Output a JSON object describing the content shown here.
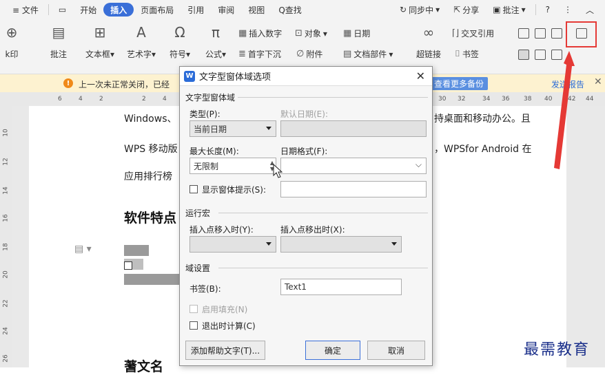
{
  "menubar": {
    "items": [
      "≡ 文件",
      "开始",
      "插入",
      "页面布局",
      "引用",
      "审阅",
      "视图"
    ],
    "active": "插入",
    "search": "Q查找",
    "sync": "同步中",
    "share": "分享",
    "comment": "批注",
    "help": "?"
  },
  "ribbon": {
    "left_cut": "k印",
    "comment": "批注",
    "textbox": "文本框",
    "art": "艺术字",
    "symbol": "符号",
    "formula": "公式",
    "insert_number": "插入数字",
    "object": "对象",
    "date": "日期",
    "dropcap": "首字下沉",
    "attach": "附件",
    "docpart": "文档部件",
    "hyperlink": "超链接",
    "crossref": "交叉引用",
    "bookmark": "书签"
  },
  "notify": {
    "message": "上一次未正常关闭，已经",
    "backup_link": "查看更多备份",
    "report": "发送报告"
  },
  "ruler": {
    "marks": [
      "6",
      "4",
      "2",
      "2",
      "4",
      "30",
      "32",
      "34",
      "36",
      "38",
      "40",
      "42",
      "44"
    ]
  },
  "vruler": {
    "marks": [
      "10",
      "12",
      "14",
      "16",
      "18",
      "20",
      "22",
      "24",
      "26"
    ]
  },
  "document": {
    "line1": "Windows、",
    "line1_end": "持桌面和移动办公。且",
    "line2": "WPS 移动版",
    "line2_end": "，WPSfor Android 在",
    "line3": "应用排行榜",
    "heading": "软件特点",
    "bottom_heading": "蓍文名"
  },
  "watermark": "最需教育",
  "dialog": {
    "title": "文字型窗体域选项",
    "section_field": "文字型窗体域",
    "type_label": "类型(P):",
    "type_value": "当前日期",
    "default_date_label": "默认日期(E):",
    "max_length_label": "最大长度(M):",
    "max_length_value": "无限制",
    "date_format_label": "日期格式(F):",
    "show_tip_label": "显示窗体提示(S):",
    "section_macro": "运行宏",
    "entry_label": "插入点移入时(Y):",
    "exit_label": "插入点移出时(X):",
    "section_field_settings": "域设置",
    "bookmark_label": "书签(B):",
    "bookmark_value": "Text1",
    "fill_enabled_label": "启用填充(N)",
    "calc_on_exit_label": "退出时计算(C)",
    "help_text_button": "添加帮助文字(T)...",
    "ok_button": "确定",
    "cancel_button": "取消"
  },
  "colors": {
    "accent": "#3a6fd8",
    "highlight": "#e53935",
    "notify_bg": "#fdf2d0"
  }
}
